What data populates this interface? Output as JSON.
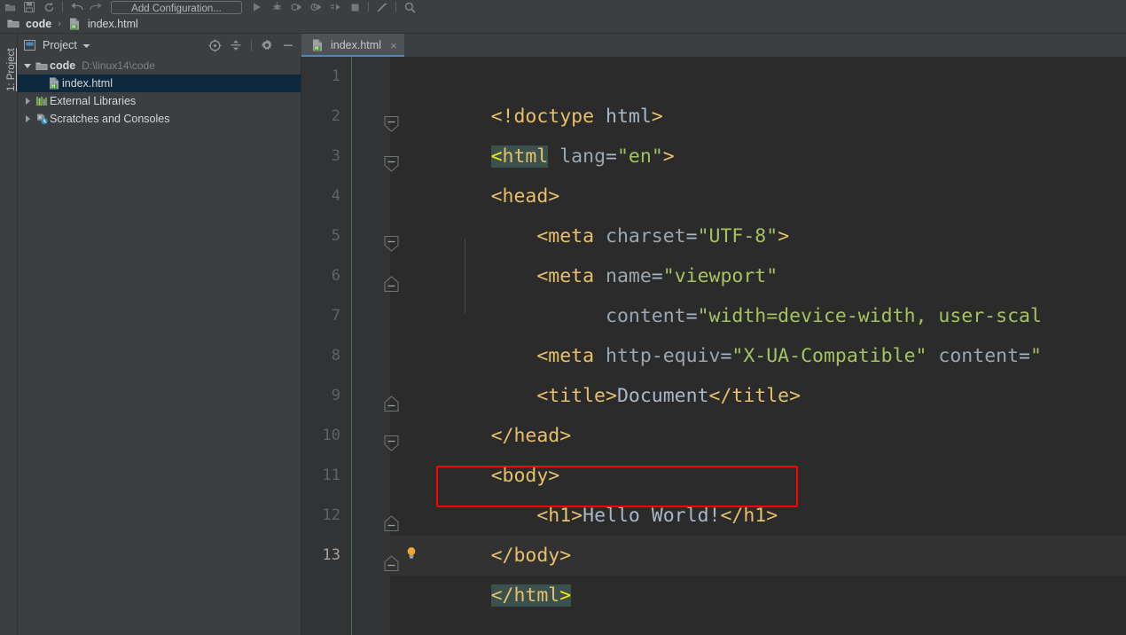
{
  "app": {
    "theme_bg": "#3C3F41",
    "editor_bg": "#2B2B2B",
    "accent": "#4A88C7",
    "annotation_color": "#FF0000"
  },
  "toolbar": {
    "run_configuration_label": "Add Configuration...",
    "icons": [
      {
        "name": "open-folder-icon"
      },
      {
        "name": "save-icon"
      },
      {
        "name": "sync-icon"
      },
      {
        "name": "undo-icon"
      },
      {
        "name": "redo-icon"
      },
      {
        "name": "run-icon"
      },
      {
        "name": "debug-icon"
      },
      {
        "name": "run-with-coverage-icon"
      },
      {
        "name": "profile-icon"
      },
      {
        "name": "run-to-cursor-icon"
      },
      {
        "name": "stop-icon"
      },
      {
        "name": "search-everywhere-icon"
      },
      {
        "name": "magnifier-icon"
      }
    ]
  },
  "breadcrumb": {
    "items": [
      {
        "label": "code",
        "icon": "folder-icon",
        "bold": true
      },
      {
        "label": "index.html",
        "icon": "html-file-icon",
        "bold": false
      }
    ],
    "separator": "›"
  },
  "tool_stripe": {
    "project_label": "1: Project"
  },
  "project_panel": {
    "title": "Project",
    "title_icon": "project-view-icon",
    "dropdown_icon": "chevron-down-icon",
    "actions": [
      {
        "name": "select-opened-file-icon",
        "label": "Select Opened File"
      },
      {
        "name": "collapse-all-icon",
        "label": "Collapse All"
      },
      {
        "name": "settings-gear-icon",
        "label": "Settings"
      },
      {
        "name": "hide-panel-icon",
        "label": "Hide"
      }
    ],
    "tree": [
      {
        "label": "code",
        "path": "D:\\linux14\\code",
        "icon": "folder-icon",
        "expanded": true,
        "bold": true,
        "indent": 0,
        "selected": false,
        "has_arrow": true
      },
      {
        "label": "index.html",
        "path": "",
        "icon": "html-file-icon",
        "expanded": false,
        "bold": false,
        "indent": 1,
        "selected": true,
        "has_arrow": false
      },
      {
        "label": "External Libraries",
        "path": "",
        "icon": "libraries-icon",
        "expanded": false,
        "bold": false,
        "indent": 0,
        "selected": false,
        "has_arrow": true
      },
      {
        "label": "Scratches and Consoles",
        "path": "",
        "icon": "scratches-icon",
        "expanded": false,
        "bold": false,
        "indent": 0,
        "selected": false,
        "has_arrow": true
      }
    ]
  },
  "editor": {
    "tabs": [
      {
        "label": "index.html",
        "icon": "html-file-icon",
        "active": true,
        "close_glyph": "×"
      }
    ],
    "current_line": 13,
    "lines": [
      {
        "number": "1",
        "fold": "none",
        "indent_guide": false
      },
      {
        "number": "2",
        "fold": "start",
        "indent_guide": false
      },
      {
        "number": "3",
        "fold": "start",
        "indent_guide": false
      },
      {
        "number": "4",
        "fold": "none",
        "indent_guide": false
      },
      {
        "number": "5",
        "fold": "start",
        "indent_guide": false
      },
      {
        "number": "6",
        "fold": "end",
        "indent_guide": true
      },
      {
        "number": "7",
        "fold": "none",
        "indent_guide": false
      },
      {
        "number": "8",
        "fold": "none",
        "indent_guide": false
      },
      {
        "number": "9",
        "fold": "end",
        "indent_guide": false
      },
      {
        "number": "10",
        "fold": "start",
        "indent_guide": false
      },
      {
        "number": "11",
        "fold": "none",
        "indent_guide": false
      },
      {
        "number": "12",
        "fold": "end",
        "indent_guide": false
      },
      {
        "number": "13",
        "fold": "end",
        "indent_guide": false
      }
    ],
    "code_text": [
      "<!doctype html>",
      "<html lang=\"en\">",
      "<head>",
      "    <meta charset=\"UTF-8\">",
      "    <meta name=\"viewport\"",
      "          content=\"width=device-width, user-scal",
      "    <meta http-equiv=\"X-UA-Compatible\" content=\"",
      "    <title>Document</title>",
      "</head>",
      "<body>",
      "    <h1>Hello World!</h1>",
      "</body>",
      "</html>"
    ],
    "annotation": {
      "type": "red-rectangle",
      "target_line": 11,
      "target_text": "<h1>Hello World!</h1>"
    },
    "matched_tag_highlight": [
      "<html",
      "</html>"
    ],
    "intention_bulb": {
      "line": 12,
      "icon": "lightbulb-icon"
    }
  }
}
